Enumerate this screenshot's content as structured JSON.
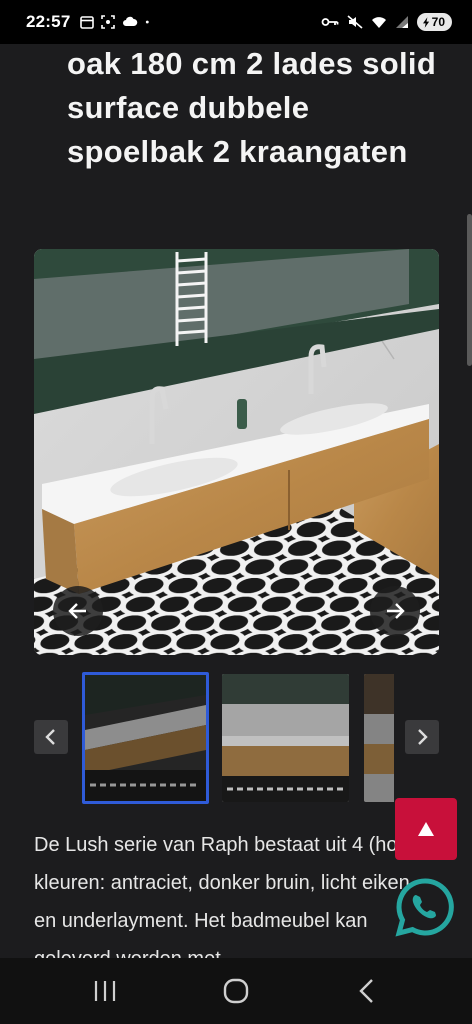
{
  "status_bar": {
    "time": "22:57",
    "battery": "70",
    "left_icons": [
      "calendar-icon",
      "screenshot-icon",
      "cloud-icon",
      "dot-icon"
    ],
    "right_icons": [
      "key-icon",
      "mute-icon",
      "wifi-icon",
      "signal-icon",
      "battery-icon"
    ]
  },
  "product": {
    "title": "oak 180 cm 2 lades solid surface dubbele spoelbak 2 kraangaten"
  },
  "gallery": {
    "main_alt": "Badmeubel met dubbele spoelbak",
    "prev_icon": "arrow-left-icon",
    "next_icon": "arrow-right-icon",
    "thumbnails": [
      {
        "selected": true
      },
      {
        "selected": false
      },
      {
        "selected": false
      }
    ],
    "thumb_prev_icon": "chevron-left-icon",
    "thumb_next_icon": "chevron-right-icon"
  },
  "description": {
    "text": "De Lush serie van Raph bestaat uit 4 (hout) kleuren: antraciet, donker bruin, licht eiken en underlayment. Het badmeubel kan geleverd worden met"
  },
  "floating": {
    "top_icon": "arrow-up-icon",
    "whatsapp_icon": "whatsapp-icon"
  },
  "colors": {
    "background": "#1c1c1e",
    "scroll_top_button": "#c8103a",
    "whatsapp": "#25a6a0",
    "selected_thumb_border": "#2f5bd8"
  },
  "nav_bar": {
    "items": [
      "recent-apps-icon",
      "home-icon",
      "back-icon"
    ]
  }
}
